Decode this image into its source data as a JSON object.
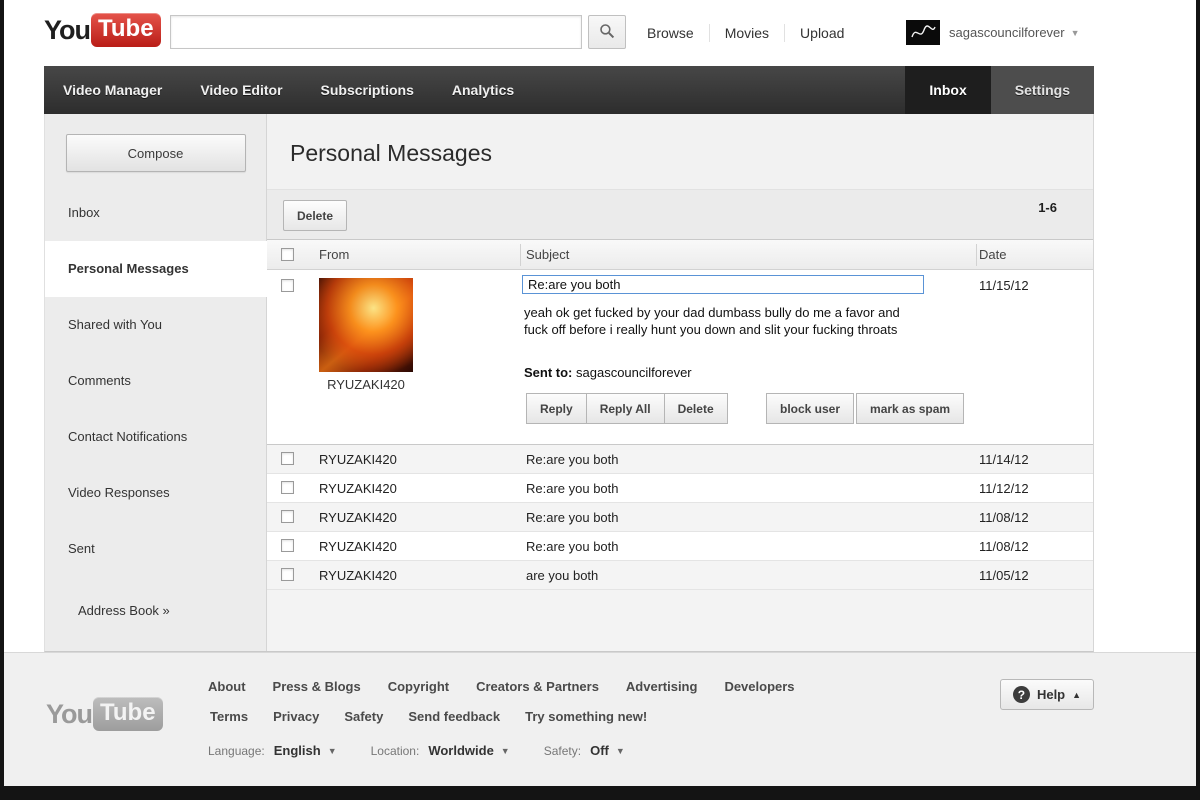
{
  "header": {
    "logo_you": "You",
    "logo_tube": "Tube",
    "search_value": "",
    "search_placeholder": "",
    "links": [
      "Browse",
      "Movies",
      "Upload"
    ],
    "user_name": "sagascouncilforever"
  },
  "nav": {
    "items": [
      "Video Manager",
      "Video Editor",
      "Subscriptions",
      "Analytics"
    ],
    "inbox_tab": "Inbox",
    "settings_tab": "Settings"
  },
  "sidebar": {
    "compose_label": "Compose",
    "items": [
      "Inbox",
      "Personal Messages",
      "Shared with You",
      "Comments",
      "Contact Notifications",
      "Video Responses",
      "Sent"
    ],
    "active_item": "Personal Messages",
    "address_book": "Address Book »"
  },
  "main": {
    "title": "Personal Messages",
    "delete_label": "Delete",
    "range": "1-6",
    "columns": {
      "from": "From",
      "subject": "Subject",
      "date": "Date"
    },
    "expanded": {
      "from": "RYUZAKI420",
      "subject": "Re:are you both",
      "body": "yeah ok get fucked by your dad dumbass bully do me a favor and fuck off before i really hunt you down and slit your fucking throats",
      "sent_to_label": "Sent to:",
      "sent_to_value": "sagascouncilforever",
      "reply": "Reply",
      "reply_all": "Reply All",
      "delete": "Delete",
      "block_user": "block user",
      "mark_as_spam": "mark as spam",
      "date": "11/15/12"
    },
    "rows": [
      {
        "from": "RYUZAKI420",
        "subject": "Re:are you both",
        "date": "11/14/12"
      },
      {
        "from": "RYUZAKI420",
        "subject": "Re:are you both",
        "date": "11/12/12"
      },
      {
        "from": "RYUZAKI420",
        "subject": "Re:are you both",
        "date": "11/08/12"
      },
      {
        "from": "RYUZAKI420",
        "subject": "Re:are you both",
        "date": "11/08/12"
      },
      {
        "from": "RYUZAKI420",
        "subject": "are you both",
        "date": "11/05/12"
      }
    ]
  },
  "footer": {
    "logo_you": "You",
    "logo_tube": "Tube",
    "links_row1": [
      "About",
      "Press & Blogs",
      "Copyright",
      "Creators & Partners",
      "Advertising",
      "Developers"
    ],
    "links_row2": [
      "Terms",
      "Privacy",
      "Safety",
      "Send feedback",
      "Try something new!"
    ],
    "language_label": "Language:",
    "language_value": "English",
    "location_label": "Location:",
    "location_value": "Worldwide",
    "safety_label": "Safety:",
    "safety_value": "Off",
    "help_label": "Help"
  },
  "colors": {
    "brand_red": "#c4302b",
    "nav_dark": "#333333",
    "focus_blue": "#5a93d6"
  }
}
